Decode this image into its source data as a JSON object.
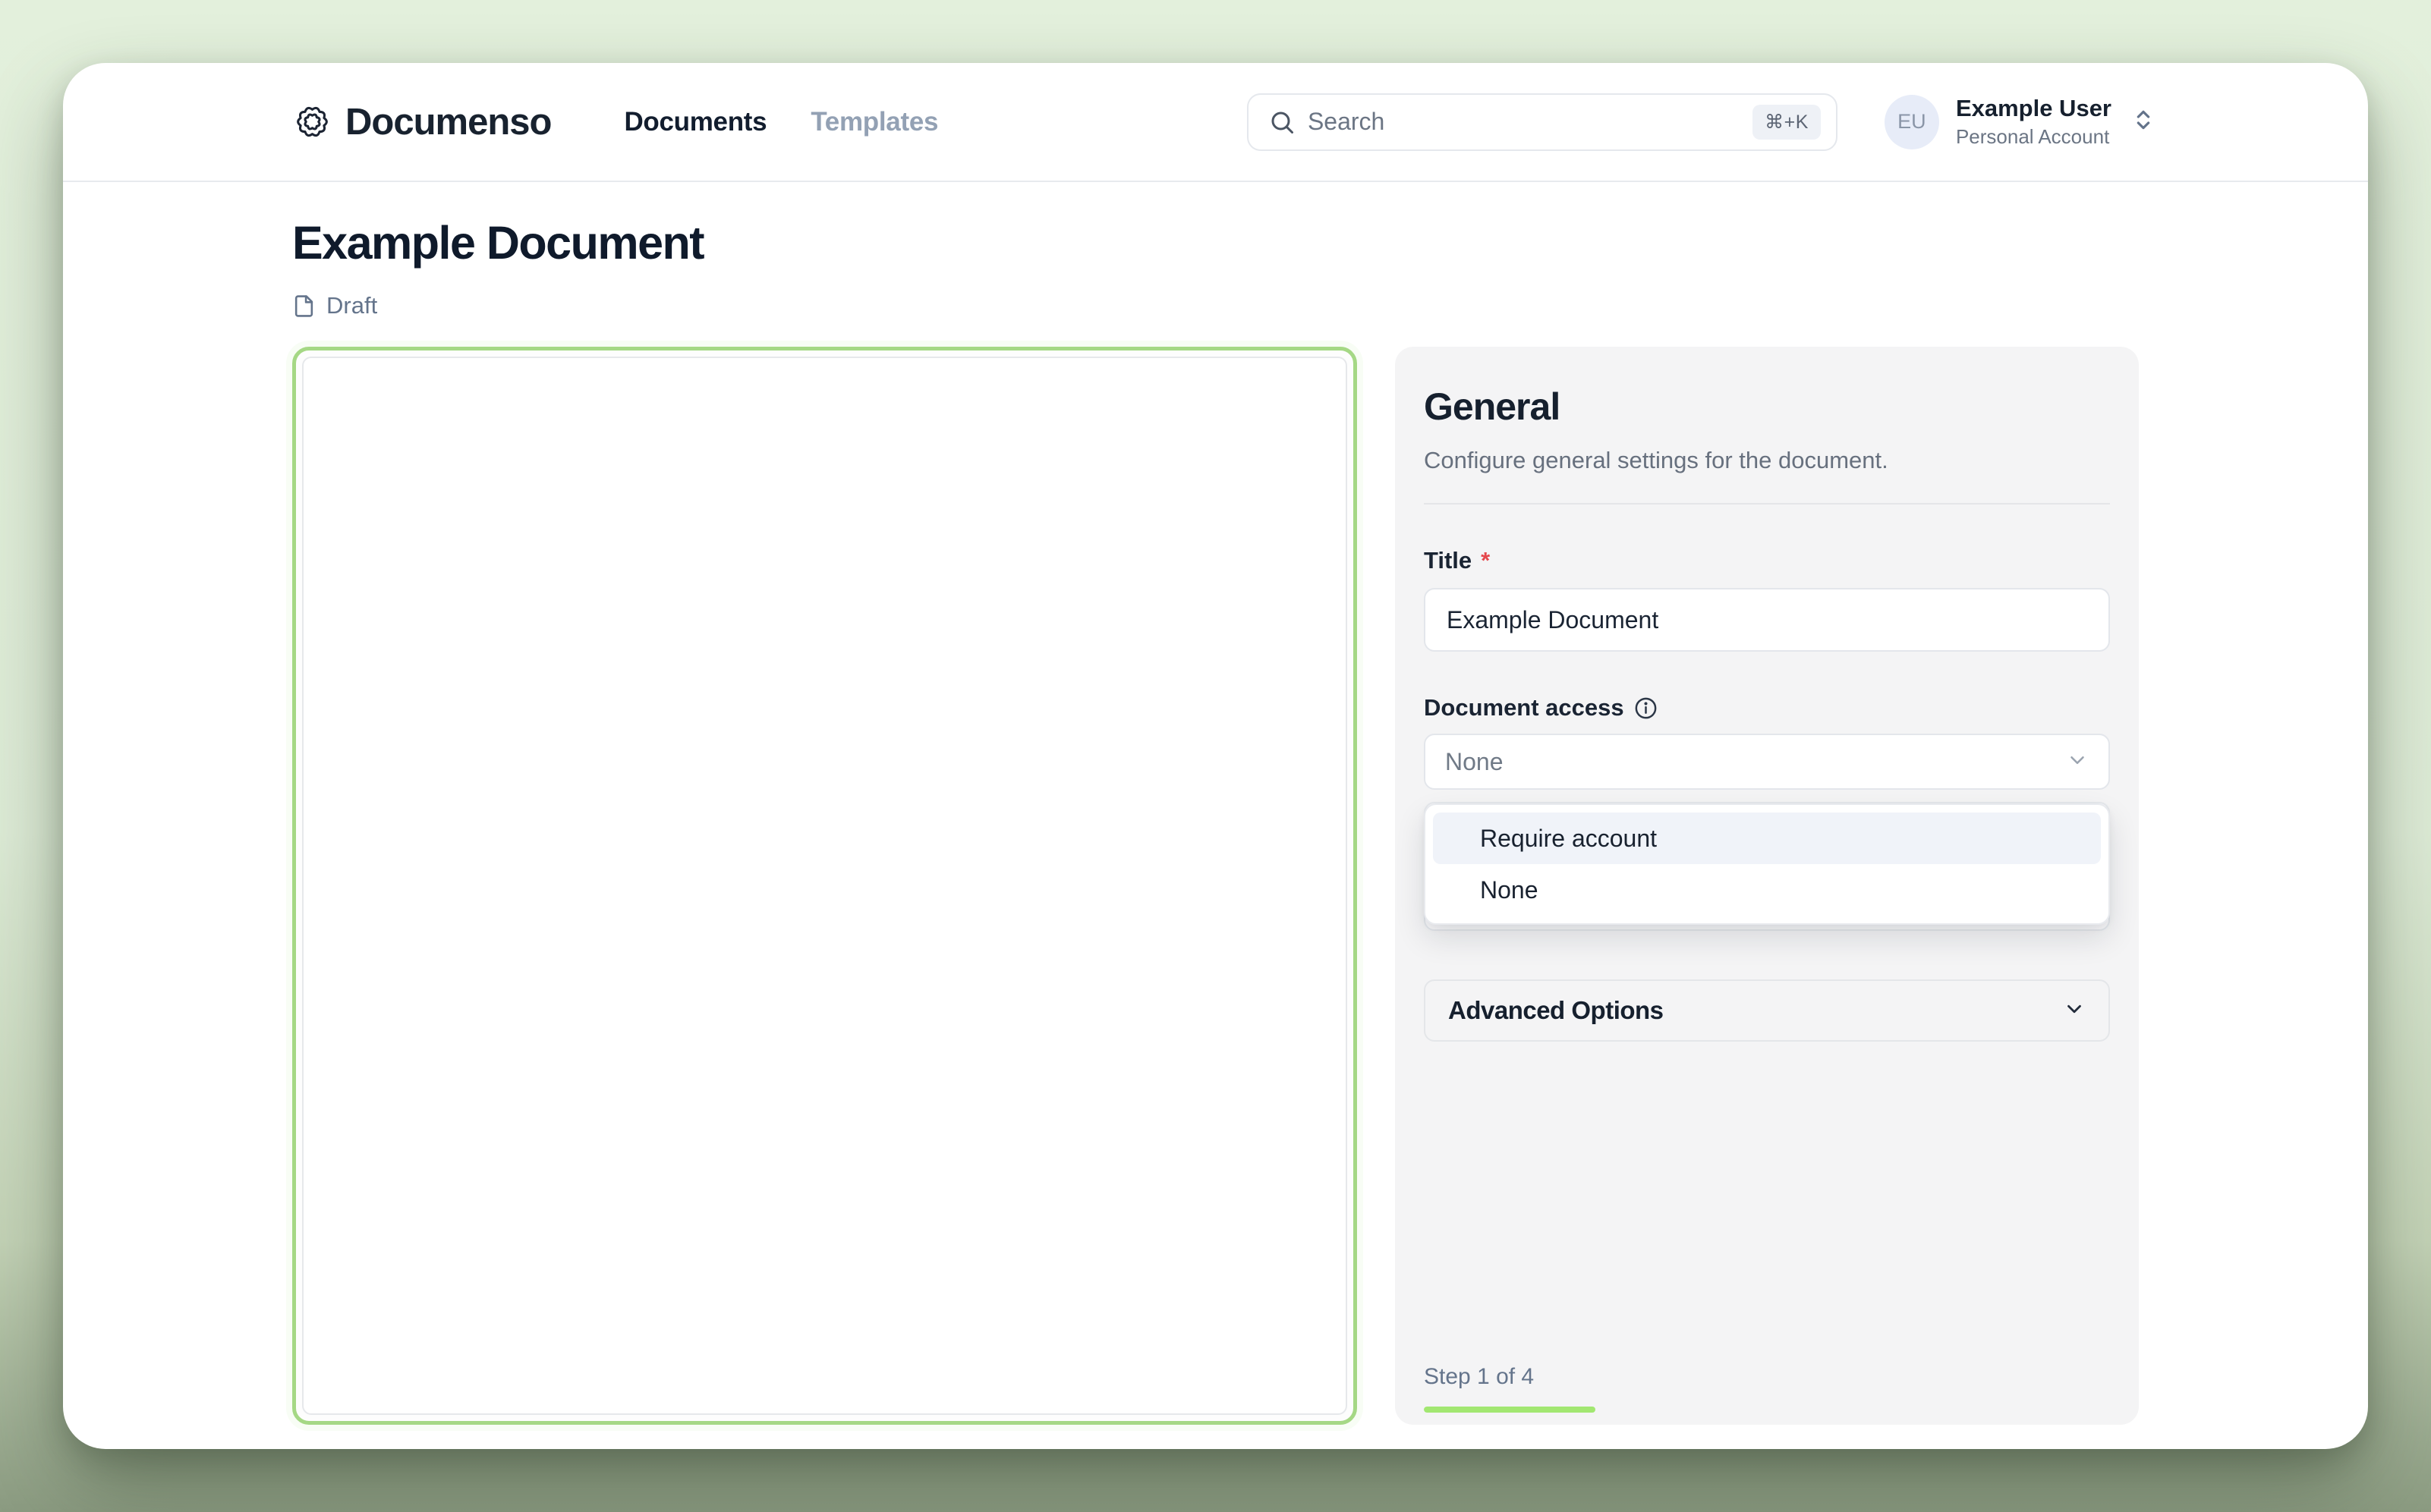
{
  "header": {
    "brand": "Documenso",
    "nav": [
      {
        "label": "Documents",
        "active": true
      },
      {
        "label": "Templates",
        "active": false
      }
    ],
    "search": {
      "placeholder": "Search",
      "shortcut": "⌘+K"
    },
    "account": {
      "initials": "EU",
      "name": "Example User",
      "type": "Personal Account"
    }
  },
  "page": {
    "title": "Example Document",
    "status": "Draft"
  },
  "panel": {
    "heading": "General",
    "description": "Configure general settings for the document.",
    "title_field": {
      "label": "Title",
      "required_marker": "*",
      "value": "Example Document"
    },
    "access_field": {
      "label": "Document access",
      "value": "None",
      "options": [
        "Require account",
        "None"
      ],
      "highlighted_option": "Require account"
    },
    "advanced": {
      "label": "Advanced Options"
    },
    "step": {
      "text": "Step 1 of 4",
      "progress_percent": 25
    }
  },
  "colors": {
    "accent_green": "#a2e771",
    "viewer_border_green": "#a5d885",
    "panel_bg": "#f4f4f5",
    "highlight_bg": "#f0f3f9",
    "required_red": "#e5484d"
  }
}
